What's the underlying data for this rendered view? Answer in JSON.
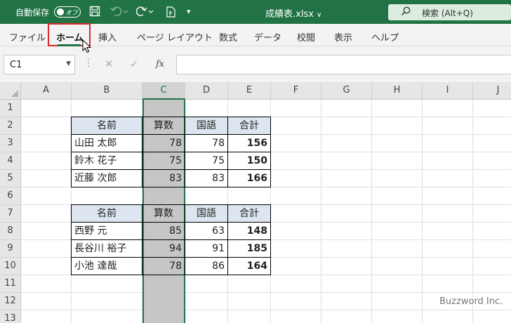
{
  "titlebar": {
    "autosave_label": "自動保存",
    "autosave_state": "オフ",
    "filename": "成績表.xlsx",
    "search_placeholder": "検索 (Alt+Q)"
  },
  "ribbon": {
    "tabs": [
      "ファイル",
      "ホーム",
      "挿入",
      "ページ レイアウト",
      "数式",
      "データ",
      "校閲",
      "表示",
      "ヘルプ"
    ],
    "active_tab": "ホーム"
  },
  "formula_bar": {
    "name_box": "C1",
    "fx_label": "fx",
    "formula": ""
  },
  "sheet": {
    "columns": [
      "A",
      "B",
      "C",
      "D",
      "E",
      "F",
      "G",
      "H",
      "I",
      "J"
    ],
    "selected_column": "C",
    "rows": [
      "1",
      "2",
      "3",
      "4",
      "5",
      "6",
      "7",
      "8",
      "9",
      "10",
      "11",
      "12",
      "13"
    ],
    "table1": {
      "headers": [
        "名前",
        "算数",
        "国語",
        "合計"
      ],
      "rows": [
        [
          "山田 太郎",
          "78",
          "78",
          "156"
        ],
        [
          "鈴木 花子",
          "75",
          "75",
          "150"
        ],
        [
          "近藤 次郎",
          "83",
          "83",
          "166"
        ]
      ]
    },
    "table2": {
      "headers": [
        "名前",
        "算数",
        "国語",
        "合計"
      ],
      "rows": [
        [
          "西野 元",
          "85",
          "63",
          "148"
        ],
        [
          "長谷川 裕子",
          "94",
          "91",
          "185"
        ],
        [
          "小池 達哉",
          "78",
          "86",
          "164"
        ]
      ]
    }
  },
  "watermark": "Buzzword Inc.",
  "colors": {
    "excel_green": "#217346",
    "highlight_red": "#e0262b",
    "header_fill": "#dde6f0"
  }
}
